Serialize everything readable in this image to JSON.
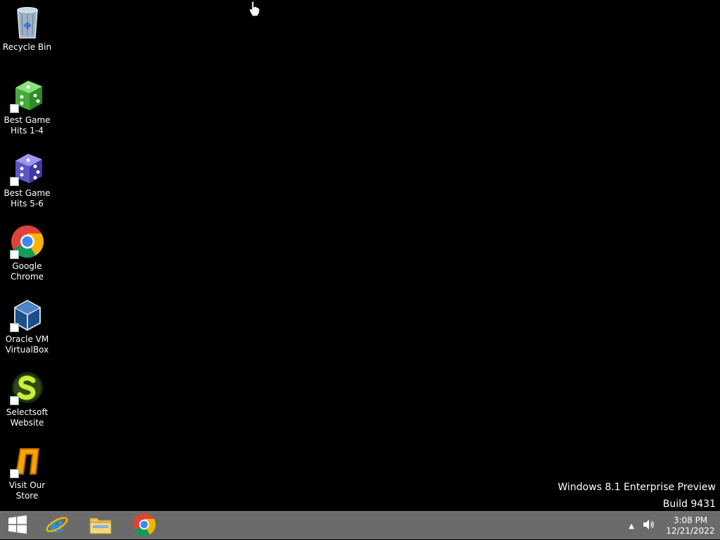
{
  "desktop": {
    "icons": [
      {
        "label": "Recycle Bin",
        "icon": "recycle-bin-icon"
      },
      {
        "label": "Best Game\nHits 1-4",
        "icon": "green-dice-icon"
      },
      {
        "label": "Best Game\nHits 5-6",
        "icon": "purple-dice-icon"
      },
      {
        "label": "Google\nChrome",
        "icon": "chrome-icon"
      },
      {
        "label": "Oracle VM\nVirtualBox",
        "icon": "virtualbox-icon"
      },
      {
        "label": "Selectsoft\nWebsite",
        "icon": "selectsoft-icon"
      },
      {
        "label": "Visit Our\nStore",
        "icon": "store-icon"
      }
    ],
    "watermark": {
      "line1": "Windows 8.1 Enterprise Preview",
      "line2": "Build 9431"
    }
  },
  "taskbar": {
    "pinned": [
      {
        "name": "start",
        "icon": "windows-logo-icon"
      },
      {
        "name": "internet-explorer",
        "icon": "internet-explorer-icon"
      },
      {
        "name": "file-explorer",
        "icon": "folder-icon"
      },
      {
        "name": "chrome",
        "icon": "chrome-icon"
      }
    ],
    "tray": {
      "time": "3:08 PM",
      "date": "12/21/2022"
    }
  },
  "colors": {
    "taskbar": "#6b6b6b",
    "desktop": "#000000"
  }
}
